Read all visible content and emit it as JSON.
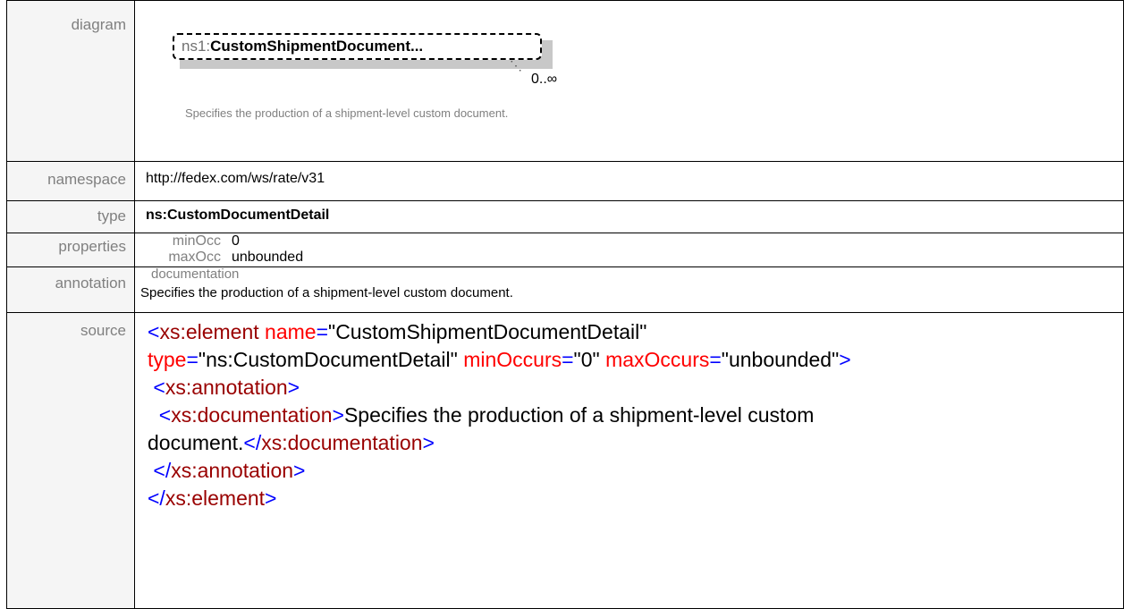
{
  "rows": {
    "diagram": {
      "label": "diagram",
      "element_prefix": "ns1:",
      "element_name": "CustomShipmentDocument...",
      "occurrence": "0..∞",
      "doc_text": "Specifies the production of a shipment-level custom document."
    },
    "namespace": {
      "label": "namespace",
      "value": "http://fedex.com/ws/rate/v31"
    },
    "type": {
      "label": "type",
      "value": "ns:CustomDocumentDetail"
    },
    "properties": {
      "label": "properties",
      "min_key": "minOcc",
      "min_val": "0",
      "max_key": "maxOcc",
      "max_val": "unbounded"
    },
    "annotation": {
      "label": "annotation",
      "heading": "documentation",
      "text": "Specifies the production of a shipment-level custom document."
    },
    "source": {
      "label": "source",
      "open_bracket": "<",
      "close_bracket": ">",
      "end_open": "</",
      "self_tag": "xs:element",
      "name_attr": "name",
      "name_val": "\"CustomShipmentDocumentDetail\"",
      "type_attr": "type",
      "type_val": "\"ns:CustomDocumentDetail\"",
      "minocc_attr": "minOccurs",
      "minocc_val": "\"0\"",
      "maxocc_attr": "maxOccurs",
      "maxocc_val": "\"unbounded\"",
      "eq": "=",
      "annotation_tag": "xs:annotation",
      "documentation_tag": "xs:documentation",
      "doc_text_1": "Specifies the production of a shipment-level custom",
      "doc_text_2": "document."
    }
  },
  "colors": {
    "tag": "#0000ff",
    "tag_name": "#990000",
    "attr": "#ff0000",
    "label": "#808080"
  }
}
